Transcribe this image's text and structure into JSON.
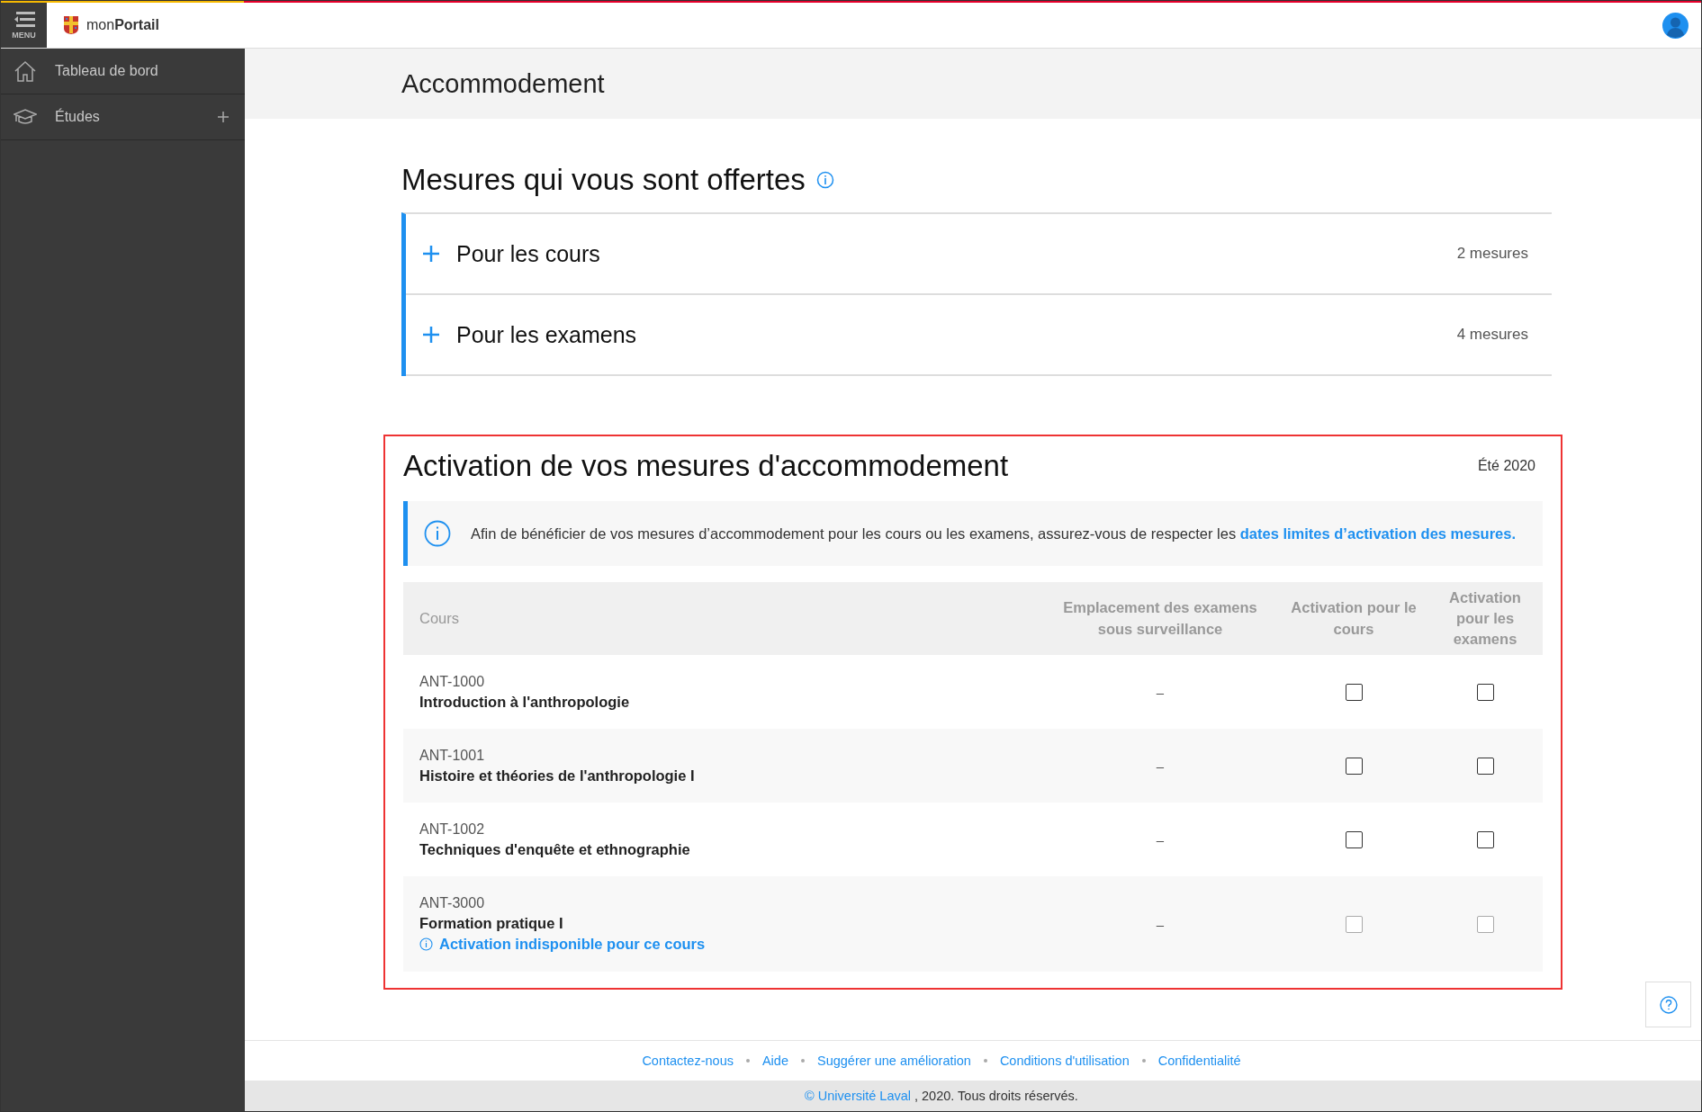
{
  "topbar": {
    "menu_label": "MENU",
    "brand": "mon**Portail**"
  },
  "sidebar": {
    "items": [
      {
        "label": "Tableau de bord",
        "kind": "home",
        "expandable": false
      },
      {
        "label": "Études",
        "kind": "studies",
        "expandable": true
      }
    ]
  },
  "page_title": "Accommodement",
  "offered": {
    "title": "Mesures qui vous sont offertes",
    "groups": [
      {
        "label": "Pour les cours",
        "count": "2 mesures",
        "expanded": false
      },
      {
        "label": "Pour les examens",
        "count": "4 mesures",
        "expanded": false
      }
    ]
  },
  "activation": {
    "title": "Activation de vos mesures d'accommodement",
    "term": "Été 2020",
    "highlighted": true,
    "notice": {
      "text": "Afin de bénéficier de vos mesures d’accommodement pour les cours ou les examens, assurez-vous de respecter les",
      "link": "dates limites d’activation des mesures."
    },
    "table": {
      "columns": [
        "Cours",
        "Emplacement des examens sous surveillance",
        "Activation pour le cours",
        "Activation pour les examens"
      ],
      "rows": [
        {
          "code": "ANT-1000",
          "name": "Introduction à l'anthropologie",
          "location": "–",
          "course_checked": false,
          "exam_checked": false,
          "disabled": false
        },
        {
          "code": "ANT-1001",
          "name": "Histoire et théories de l'anthropologie I",
          "location": "–",
          "course_checked": false,
          "exam_checked": false,
          "disabled": false
        },
        {
          "code": "ANT-1002",
          "name": "Techniques d'enquête et ethnographie",
          "location": "–",
          "course_checked": false,
          "exam_checked": false,
          "disabled": false
        },
        {
          "code": "ANT-3000",
          "name": "Formation pratique I",
          "note": "Activation indisponible pour ce cours",
          "location": "–",
          "course_checked": false,
          "exam_checked": false,
          "disabled": true
        }
      ]
    }
  },
  "footer": {
    "links": [
      "Contactez-nous",
      "Aide",
      "Suggérer une amélioration",
      "Conditions d'utilisation",
      "Confidentialité"
    ],
    "copyright_link": "© Université Laval",
    "copyright_text": ", 2020. Tous droits réservés."
  }
}
